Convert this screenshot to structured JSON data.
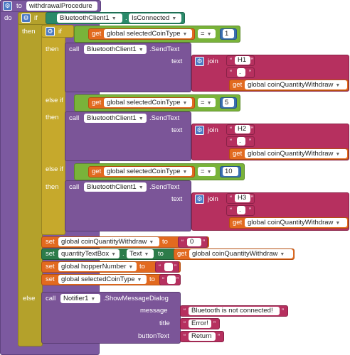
{
  "procedure": {
    "keyword": "to",
    "name": "withdrawalProcedure",
    "do": "do"
  },
  "if_block": {
    "if": "if",
    "then": "then",
    "else": "else",
    "else_if": "else if"
  },
  "bluetooth": {
    "component": "BluetoothClient1",
    "property": "IsConnected",
    "method": "SendText",
    "text_param": "text"
  },
  "common": {
    "call": "call",
    "get": "get",
    "set": "set",
    "to": "to",
    "join": "join",
    "eq": "="
  },
  "branches": [
    {
      "coin_var": "global selectedCoinType",
      "value": "1",
      "h": "H1",
      "sep": ".",
      "qty_var": "global coinQuantityWithdraw"
    },
    {
      "coin_var": "global selectedCoinType",
      "value": "5",
      "h": "H2",
      "sep": ".",
      "qty_var": "global coinQuantityWithdraw"
    },
    {
      "coin_var": "global selectedCoinType",
      "value": "10",
      "h": "H3",
      "sep": ".",
      "qty_var": "global coinQuantityWithdraw"
    }
  ],
  "sets": {
    "s1_var": "global coinQuantityWithdraw",
    "s1_val": "0",
    "s2_comp": "quantityTextBox",
    "s2_prop": "Text",
    "s2_get": "global coinQuantityWithdraw",
    "s3_var": "global hopperNumber",
    "s3_val": " ",
    "s4_var": "global selectedCoinType",
    "s4_val": " "
  },
  "notifier": {
    "component": "Notifier1",
    "method": "ShowMessageDialog",
    "message_label": "message",
    "message": "Bluetooth is not connected!",
    "title_label": "title",
    "title": "Error!",
    "button_label": "buttonText",
    "button": "Return"
  },
  "colors": {
    "procedure": "#7c59a0",
    "control": "#b4a12b",
    "variable": "#e26a1f",
    "text": "#b6305f",
    "logic": "#79b33a",
    "math": "#3a6fb0",
    "component": "#7b5598"
  }
}
